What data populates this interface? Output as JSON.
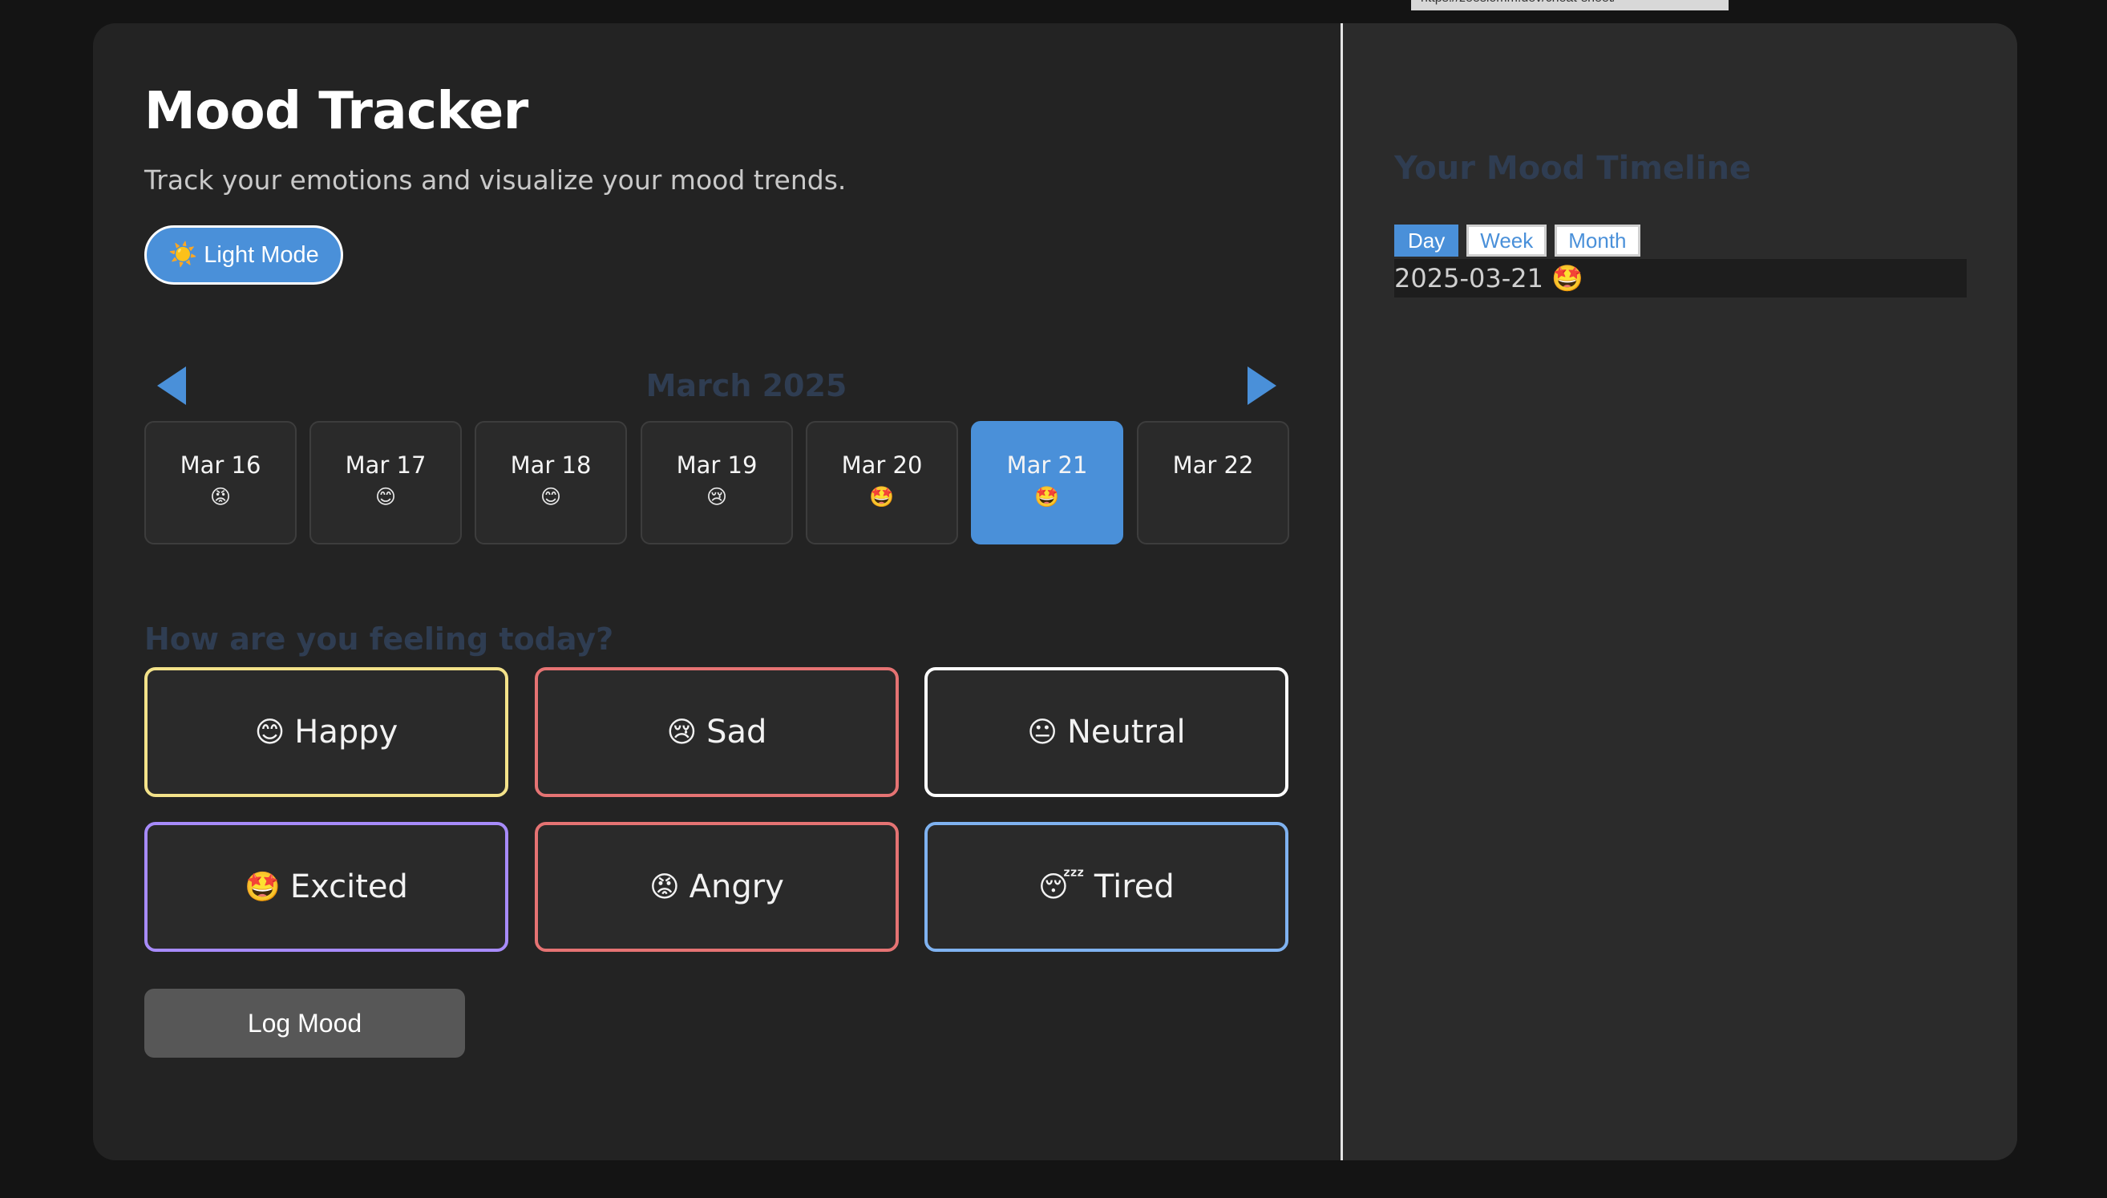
{
  "browser": {
    "url_tooltip": "https://zeeslomm.dev/cheat-sheet/"
  },
  "app": {
    "title": "Mood Tracker",
    "subtitle": "Track your emotions and visualize your mood trends.",
    "theme_toggle": {
      "icon": "☀️",
      "label": "Light Mode"
    }
  },
  "calendar": {
    "month_label": "March 2025",
    "prev_icon": "triangle-left-icon",
    "next_icon": "triangle-right-icon",
    "days": [
      {
        "date": "Mar 16",
        "emoji": "😡",
        "selected": false
      },
      {
        "date": "Mar 17",
        "emoji": "😊",
        "selected": false
      },
      {
        "date": "Mar 18",
        "emoji": "😊",
        "selected": false
      },
      {
        "date": "Mar 19",
        "emoji": "😢",
        "selected": false
      },
      {
        "date": "Mar 20",
        "emoji": "🤩",
        "selected": false
      },
      {
        "date": "Mar 21",
        "emoji": "🤩",
        "selected": true
      },
      {
        "date": "Mar 22",
        "emoji": "",
        "selected": false
      }
    ]
  },
  "mood_picker": {
    "question": "How are you feeling today?",
    "moods": [
      {
        "emoji": "😊",
        "label": "Happy",
        "border_color": "#f3e28a"
      },
      {
        "emoji": "😢",
        "label": "Sad",
        "border_color": "#e57373"
      },
      {
        "emoji": "😐",
        "label": "Neutral",
        "border_color": "#ffffff"
      },
      {
        "emoji": "🤩",
        "label": "Excited",
        "border_color": "#a78bfa"
      },
      {
        "emoji": "😡",
        "label": "Angry",
        "border_color": "#e57373"
      },
      {
        "emoji": "😴",
        "label": "Tired",
        "border_color": "#7fb2f0"
      }
    ],
    "log_button": "Log Mood"
  },
  "timeline": {
    "title": "Your Mood Timeline",
    "tabs": [
      {
        "label": "Day",
        "active": true
      },
      {
        "label": "Week",
        "active": false
      },
      {
        "label": "Month",
        "active": false
      }
    ],
    "entries": [
      {
        "date": "2025-03-21",
        "emoji": "🤩"
      }
    ]
  },
  "colors": {
    "accent": "#4a90d9",
    "panel_bg": "#232323",
    "sidebar_bg": "#2b2b2b",
    "page_bg": "#141414",
    "muted_heading": "#2f3d52"
  }
}
